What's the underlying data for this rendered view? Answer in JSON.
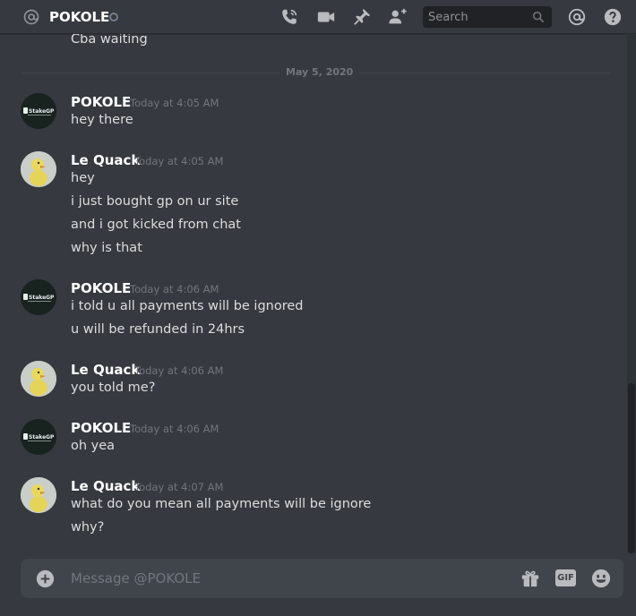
{
  "header": {
    "title": "POKOLE",
    "search_placeholder": "Search",
    "icons": [
      "at-icon",
      "voice-call-icon",
      "video-call-icon",
      "pin-icon",
      "add-friend-icon",
      "search-icon",
      "mention-icon",
      "help-icon"
    ]
  },
  "messages_view": {
    "partial_previous_line": "Cba waiting",
    "date_divider": "May 5, 2020",
    "groups": [
      {
        "author": "POKOLE",
        "timestamp": "Today at 4:05 AM",
        "lines": [
          "hey there"
        ]
      },
      {
        "author": "Le Quack",
        "timestamp": "Today at 4:05 AM",
        "lines": [
          "hey",
          "i just bought gp on ur site",
          "and i got kicked from chat",
          "why is that"
        ]
      },
      {
        "author": "POKOLE",
        "timestamp": "Today at 4:06 AM",
        "lines": [
          "i told u all payments will be ignored",
          "u will be refunded in 24hrs"
        ]
      },
      {
        "author": "Le Quack",
        "timestamp": "Today at 4:06 AM",
        "lines": [
          "you told me?"
        ]
      },
      {
        "author": "POKOLE",
        "timestamp": "Today at 4:06 AM",
        "lines": [
          "oh yea"
        ]
      },
      {
        "author": "Le Quack",
        "timestamp": "Today at 4:07 AM",
        "lines": [
          "what do you mean all payments will be ignore",
          "why?"
        ]
      }
    ]
  },
  "composer": {
    "placeholder": "Message @POKOLE",
    "gif_label": "GIF"
  },
  "colors": {
    "background": "#36393f",
    "header_text": "#ffffff",
    "message_text": "#dcddde",
    "timestamp": "#72767d",
    "composer_bg": "#40444b",
    "search_bg": "#202225"
  }
}
